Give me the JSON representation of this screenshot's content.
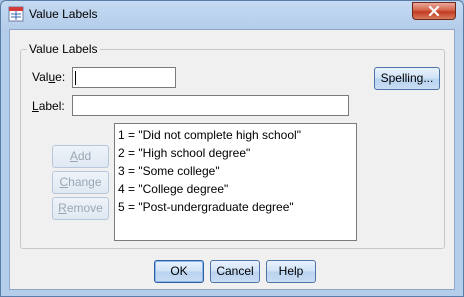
{
  "window": {
    "title": "Value Labels"
  },
  "group": {
    "title": "Value Labels"
  },
  "fields": {
    "value": {
      "label_pre": "Val",
      "label_accel": "u",
      "label_post": "e:",
      "value": ""
    },
    "label": {
      "label_pre": "",
      "label_accel": "L",
      "label_post": "abel:",
      "value": ""
    }
  },
  "buttons": {
    "spelling": {
      "pre": "Spellin",
      "accel": "g",
      "post": "..."
    },
    "add": {
      "pre": "",
      "accel": "A",
      "post": "dd"
    },
    "change": {
      "pre": "",
      "accel": "C",
      "post": "hange"
    },
    "remove": {
      "pre": "",
      "accel": "R",
      "post": "emove"
    },
    "ok": "OK",
    "cancel": "Cancel",
    "help": "Help"
  },
  "list": {
    "items": [
      "1 = \"Did not complete high school\"",
      "2 = \"High school degree\"",
      "3 = \"Some college\"",
      "4 = \"College degree\"",
      "5 = \"Post-undergraduate degree\""
    ]
  },
  "icons": {
    "app": "value-labels-app-icon",
    "close": "close-icon"
  },
  "colors": {
    "close_button": "#c23b22",
    "button_border": "#4f74a8",
    "disabled_text": "#9aa6b4"
  }
}
